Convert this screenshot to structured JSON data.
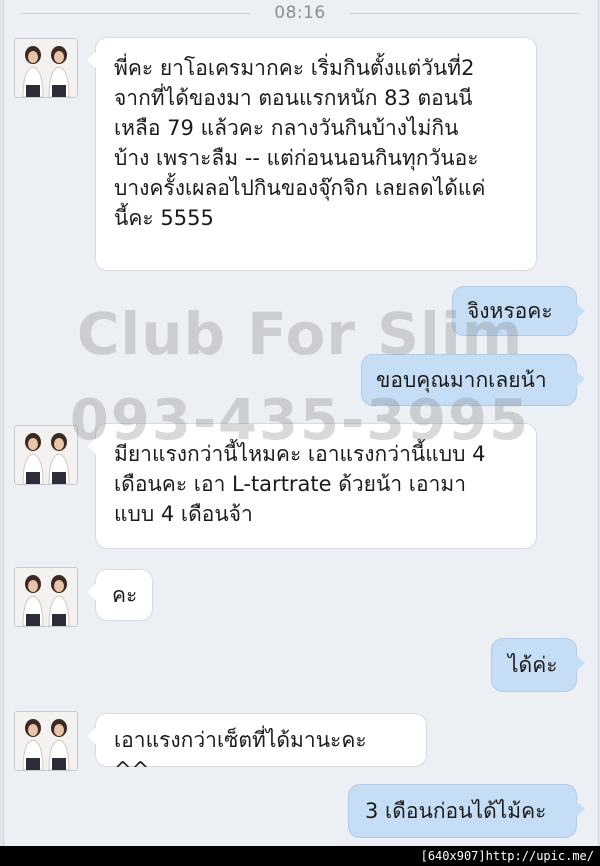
{
  "timestamp": "08:16",
  "watermark": {
    "brand": "Club For Slim",
    "phone": "093-435-3995"
  },
  "messages": [
    {
      "sender": "contact",
      "text": "พี่คะ ยาโอเครมากคะ เริ่มกินตั้งแต่วันที่2\nจากที่ได้ของมา ตอนแรกหนัก 83 ตอนนี\nเหลือ 79 แล้วคะ กลางวันกินบ้างไม่กิน\nบ้าง เพราะลืม -- แต่ก่อนนอนกินทุกวันอะ\nบางครั้งเผลอไปกินของจุ๊กจิก เลยลดได้แค่\nนี้คะ 5555"
    },
    {
      "sender": "me",
      "text": "จิงหรอคะ"
    },
    {
      "sender": "me",
      "text": "ขอบคุณมากเลยน้า"
    },
    {
      "sender": "contact",
      "text": "มียาแรงกว่านี้ไหมคะ เอาแรงกว่านี้แบบ 4\nเดือนคะ เอา L-tartrate ด้วยน้า เอามา\nแบบ 4 เดือนจ้า"
    },
    {
      "sender": "contact",
      "text": "คะ"
    },
    {
      "sender": "me",
      "text": "ได้ค่ะ"
    },
    {
      "sender": "contact",
      "text": "เอาแรงกว่าเซ็ตที่ได้มานะคะ ^^"
    },
    {
      "sender": "me",
      "text": "3 เดือนก่อนได้ไม้คะ"
    }
  ],
  "footer": {
    "text": "[640x907]http://upic.me/"
  },
  "colors": {
    "background": "#eceff4",
    "incoming_bubble": "#ffffff",
    "outgoing_bubble": "#c5def5"
  }
}
